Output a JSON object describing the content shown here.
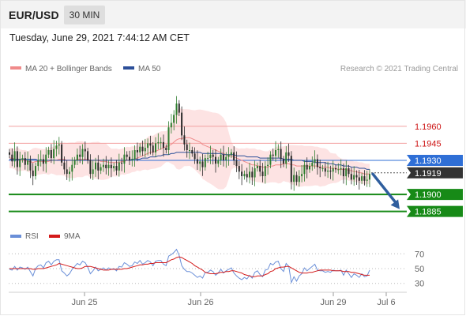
{
  "header": {
    "pair": "EUR/USD",
    "timeframe": "30 MIN",
    "datetime": "Tuesday, June 29, 2021 7:44:12 AM CET"
  },
  "legend": {
    "ma20": "MA 20 + Bollinger Bands",
    "ma50": "MA 50",
    "credit": "Research © 2021 Trading Central"
  },
  "rsi_legend": {
    "rsi": "RSI",
    "ma9": "9MA"
  },
  "colors": {
    "ma20": "#f08a8a",
    "ma50": "#2c4f99",
    "band_fill": "#fde3e3",
    "resistance": "#f2a0a0",
    "resistance_text": "#cc1111",
    "pivot": "#2f6fd6",
    "support": "#178a17",
    "last_price": "#333333",
    "candle_up": "#2e7d2e",
    "candle_down": "#2a2a2a",
    "arrow": "#2f5e9e",
    "rsi": "#6a8fd8",
    "rsi_ma": "#d41a1a"
  },
  "chart_data": [
    {
      "type": "candlestick",
      "title": "EUR/USD 30 MIN",
      "x_ticks": [
        "Jun 25",
        "Jun 26",
        "Jun 29",
        "Jul 6"
      ],
      "ylim": [
        1.1875,
        1.2003
      ],
      "levels": [
        {
          "name": "resistance",
          "value": 1.196,
          "label": "1.1960"
        },
        {
          "name": "resistance",
          "value": 1.1945,
          "label": "1.1945"
        },
        {
          "name": "pivot",
          "value": 1.193,
          "label": "1.1930"
        },
        {
          "name": "last",
          "value": 1.1919,
          "label": "1.1919"
        },
        {
          "name": "support",
          "value": 1.19,
          "label": "1.1900"
        },
        {
          "name": "support",
          "value": 1.1885,
          "label": "1.1885"
        }
      ],
      "forecast_arrow": {
        "from": 1.1918,
        "to": 1.1887
      },
      "close": [
        1.1935,
        1.1929,
        1.1938,
        1.1924,
        1.1931,
        1.1932,
        1.1926,
        1.193,
        1.1921,
        1.1916,
        1.1925,
        1.193,
        1.1931,
        1.1927,
        1.1935,
        1.1939,
        1.1932,
        1.194,
        1.1943,
        1.1944,
        1.1928,
        1.1922,
        1.1918,
        1.192,
        1.1926,
        1.193,
        1.1935,
        1.1933,
        1.194,
        1.1938,
        1.193,
        1.1918,
        1.1922,
        1.1928,
        1.1921,
        1.1924,
        1.1926,
        1.1923,
        1.1926,
        1.1923,
        1.1925,
        1.1921,
        1.1928,
        1.1927,
        1.1935,
        1.1933,
        1.193,
        1.1931,
        1.1939,
        1.1937,
        1.1942,
        1.1938,
        1.1941,
        1.1945,
        1.1943,
        1.1937,
        1.1945,
        1.1946,
        1.1946,
        1.1941,
        1.1939,
        1.1959,
        1.1963,
        1.197,
        1.198,
        1.1972,
        1.1952,
        1.1944,
        1.1939,
        1.1939,
        1.1936,
        1.1931,
        1.1927,
        1.1929,
        1.1924,
        1.1932,
        1.1932,
        1.1935,
        1.1933,
        1.1927,
        1.193,
        1.1935,
        1.193,
        1.1933,
        1.1935,
        1.1937,
        1.193,
        1.1925,
        1.192,
        1.1916,
        1.1918,
        1.1915,
        1.192,
        1.1915,
        1.1923,
        1.1925,
        1.192,
        1.1916,
        1.1925,
        1.1926,
        1.1935,
        1.1934,
        1.1939,
        1.194,
        1.1931,
        1.1927,
        1.1937,
        1.1934,
        1.1911,
        1.1917,
        1.1911,
        1.1916,
        1.1918,
        1.1926,
        1.1922,
        1.1925,
        1.1928,
        1.1931,
        1.1924,
        1.1923,
        1.1923,
        1.192,
        1.1921,
        1.192,
        1.1923,
        1.1922,
        1.1922,
        1.1923,
        1.1916,
        1.1923,
        1.1918,
        1.1913,
        1.1917,
        1.1915,
        1.1912,
        1.1916,
        1.1912,
        1.1913,
        1.1918
      ],
      "ma20": [
        1.1932,
        1.1932,
        1.1931,
        1.1931,
        1.193,
        1.193,
        1.193,
        1.1929,
        1.1929,
        1.1928,
        1.1929,
        1.1929,
        1.1929,
        1.1929,
        1.1929,
        1.1929,
        1.193,
        1.193,
        1.193,
        1.1931,
        1.1931,
        1.1931,
        1.193,
        1.193,
        1.193,
        1.193,
        1.1931,
        1.1931,
        1.1931,
        1.1931,
        1.1931,
        1.193,
        1.193,
        1.193,
        1.193,
        1.1929,
        1.1929,
        1.1929,
        1.1928,
        1.1928,
        1.1928,
        1.1928,
        1.1928,
        1.1929,
        1.1929,
        1.193,
        1.193,
        1.1931,
        1.1931,
        1.1932,
        1.1933,
        1.1934,
        1.1935,
        1.1936,
        1.1937,
        1.1937,
        1.1938,
        1.1939,
        1.194,
        1.1941,
        1.1942,
        1.1943,
        1.1944,
        1.1946,
        1.1948,
        1.1949,
        1.1949,
        1.195,
        1.195,
        1.195,
        1.1949,
        1.1948,
        1.1947,
        1.1946,
        1.1944,
        1.1943,
        1.1942,
        1.1941,
        1.194,
        1.1939,
        1.1938,
        1.1937,
        1.1936,
        1.1935,
        1.1934,
        1.1934,
        1.1933,
        1.1932,
        1.1931,
        1.193,
        1.1929,
        1.1928,
        1.1927,
        1.1926,
        1.1926,
        1.1925,
        1.1925,
        1.1924,
        1.1924,
        1.1924,
        1.1925,
        1.1925,
        1.1926,
        1.1926,
        1.1926,
        1.1927,
        1.1927,
        1.1927,
        1.1926,
        1.1926,
        1.1925,
        1.1925,
        1.1925,
        1.1925,
        1.1925,
        1.1925,
        1.1925,
        1.1925,
        1.1925,
        1.1924,
        1.1924,
        1.1924,
        1.1924,
        1.1923,
        1.1923,
        1.1923,
        1.1922,
        1.1922,
        1.1922,
        1.1922,
        1.1921,
        1.1921,
        1.192,
        1.192,
        1.1919,
        1.1919,
        1.1918,
        1.1918,
        1.1918
      ],
      "ma50": [
        1.1931,
        1.1931,
        1.1931,
        1.1931,
        1.1931,
        1.1931,
        1.1931,
        1.1931,
        1.1931,
        1.1931,
        1.1931,
        1.193,
        1.193,
        1.193,
        1.193,
        1.193,
        1.193,
        1.193,
        1.193,
        1.193,
        1.193,
        1.193,
        1.193,
        1.193,
        1.193,
        1.193,
        1.193,
        1.193,
        1.193,
        1.193,
        1.193,
        1.193,
        1.193,
        1.193,
        1.193,
        1.193,
        1.193,
        1.193,
        1.193,
        1.193,
        1.193,
        1.193,
        1.193,
        1.193,
        1.193,
        1.193,
        1.193,
        1.1931,
        1.1931,
        1.1931,
        1.1931,
        1.1932,
        1.1932,
        1.1932,
        1.1933,
        1.1933,
        1.1933,
        1.1934,
        1.1934,
        1.1935,
        1.1935,
        1.1935,
        1.1936,
        1.1936,
        1.1937,
        1.1937,
        1.1937,
        1.1937,
        1.1937,
        1.1937,
        1.1937,
        1.1937,
        1.1937,
        1.1937,
        1.1936,
        1.1936,
        1.1936,
        1.1936,
        1.1936,
        1.1936,
        1.1936,
        1.1936,
        1.1935,
        1.1935,
        1.1935,
        1.1935,
        1.1935,
        1.1934,
        1.1934,
        1.1934,
        1.1934,
        1.1933,
        1.1933,
        1.1933,
        1.1933,
        1.1933,
        1.1932,
        1.1932,
        1.1932,
        1.1932,
        1.1932,
        1.1932,
        1.1932,
        1.1932,
        1.1932,
        1.1931,
        1.1931,
        1.1931,
        1.1931,
        1.193,
        1.193,
        1.193,
        1.193,
        1.1929,
        1.1929,
        1.1929,
        1.1929,
        1.1928,
        1.1928,
        1.1928,
        1.1928,
        1.1928,
        1.1927,
        1.1927,
        1.1927,
        1.1926,
        1.1926,
        1.1926,
        1.1925,
        1.1925,
        1.1925,
        1.1924,
        1.1924,
        1.1924,
        1.1923,
        1.1923,
        1.1923,
        1.1922,
        1.1922
      ]
    },
    {
      "type": "line",
      "title": "RSI",
      "y_ticks": [
        "70",
        "50",
        "30"
      ],
      "ylim": [
        20,
        80
      ],
      "series": [
        {
          "name": "RSI",
          "values": [
            49,
            48,
            53,
            48,
            52,
            51,
            49,
            52,
            46,
            40,
            50,
            54,
            55,
            51,
            58,
            60,
            55,
            60,
            62,
            62,
            47,
            44,
            40,
            43,
            49,
            53,
            57,
            55,
            60,
            58,
            52,
            43,
            47,
            52,
            47,
            49,
            51,
            48,
            51,
            49,
            50,
            47,
            53,
            52,
            58,
            56,
            53,
            54,
            59,
            57,
            61,
            56,
            58,
            61,
            59,
            54,
            60,
            61,
            61,
            56,
            54,
            67,
            69,
            72,
            76,
            68,
            54,
            49,
            46,
            46,
            44,
            41,
            38,
            40,
            37,
            45,
            45,
            48,
            46,
            41,
            44,
            49,
            44,
            47,
            49,
            51,
            44,
            40,
            37,
            35,
            38,
            36,
            41,
            37,
            45,
            47,
            42,
            39,
            48,
            49,
            57,
            55,
            59,
            60,
            50,
            46,
            57,
            53,
            31,
            39,
            33,
            40,
            43,
            51,
            47,
            50,
            53,
            56,
            48,
            47,
            47,
            45,
            46,
            45,
            48,
            47,
            47,
            48,
            41,
            48,
            43,
            38,
            43,
            41,
            38,
            43,
            39,
            40,
            48
          ]
        },
        {
          "name": "9MA",
          "values": [
            50,
            50,
            50,
            50,
            50,
            50,
            50,
            50,
            50,
            49,
            49,
            50,
            50,
            50,
            51,
            52,
            53,
            54,
            55,
            57,
            56,
            55,
            54,
            53,
            52,
            51,
            50,
            50,
            51,
            53,
            53,
            53,
            52,
            51,
            50,
            49,
            48,
            48,
            48,
            49,
            49,
            49,
            49,
            49,
            50,
            50,
            51,
            52,
            53,
            54,
            55,
            55,
            56,
            56,
            57,
            57,
            58,
            58,
            58,
            58,
            58,
            60,
            62,
            63,
            65,
            66,
            65,
            63,
            61,
            59,
            57,
            54,
            52,
            50,
            48,
            45,
            44,
            43,
            43,
            43,
            44,
            45,
            45,
            46,
            46,
            47,
            47,
            46,
            45,
            44,
            42,
            41,
            40,
            39,
            39,
            40,
            40,
            40,
            42,
            43,
            46,
            47,
            50,
            51,
            52,
            52,
            53,
            53,
            51,
            49,
            47,
            45,
            44,
            44,
            44,
            45,
            45,
            46,
            47,
            48,
            48,
            48,
            48,
            48,
            47,
            47,
            47,
            47,
            46,
            46,
            46,
            45,
            45,
            44,
            43,
            42,
            41,
            41,
            41
          ]
        }
      ]
    }
  ]
}
